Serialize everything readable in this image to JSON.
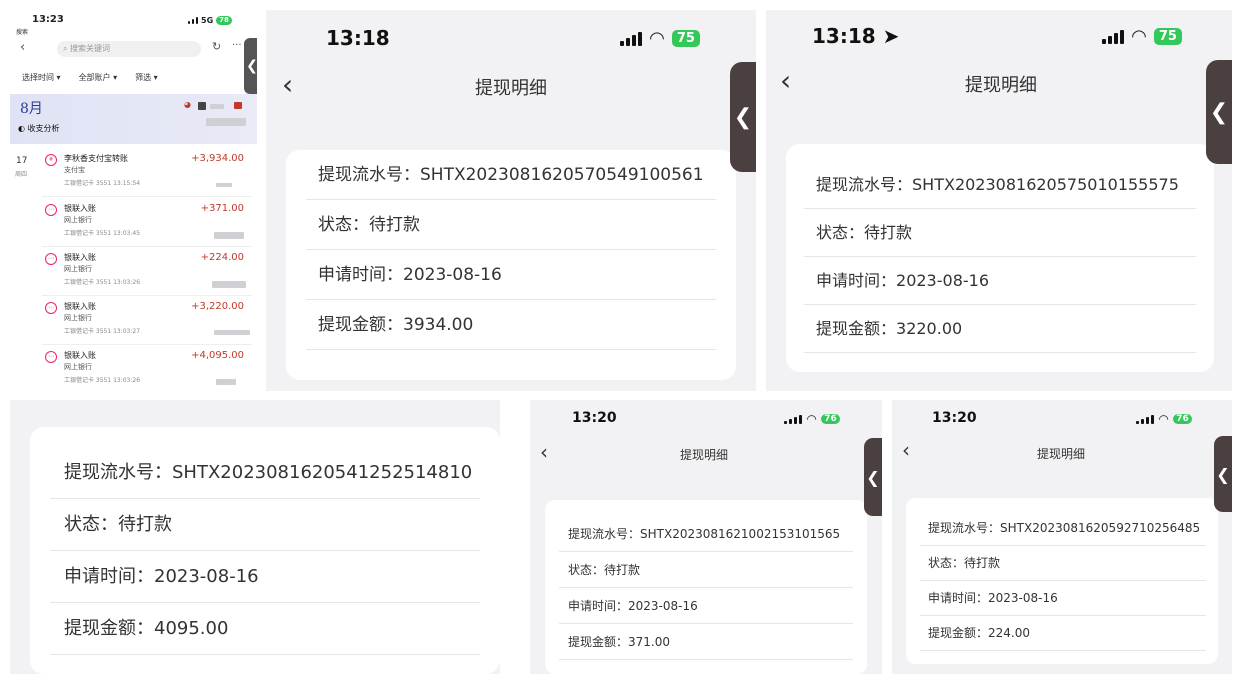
{
  "bank_app": {
    "time": "13:23",
    "back_label": "搜索",
    "network": "5G",
    "battery": "78",
    "search_placeholder": "搜索关键词",
    "filters": [
      "选择时间 ▾",
      "全部账户 ▾",
      "筛选 ▾"
    ],
    "month": "8月",
    "analysis": "收支分析",
    "day": "17",
    "weekday": "周四",
    "transactions": [
      {
        "name": "李秋香支付宝转账",
        "sub": "支付宝",
        "meta": "工银借记卡 3551 13:15:54",
        "amount": "+3,934.00"
      },
      {
        "name": "银联入账",
        "sub": "网上银行",
        "meta": "工银借记卡 3551 13:03:45",
        "amount": "+371.00"
      },
      {
        "name": "银联入账",
        "sub": "网上银行",
        "meta": "工银借记卡 3551 13:03:26",
        "amount": "+224.00"
      },
      {
        "name": "银联入账",
        "sub": "网上银行",
        "meta": "工银借记卡 3551 13:03:27",
        "amount": "+3,220.00"
      },
      {
        "name": "银联入账",
        "sub": "网上银行",
        "meta": "工银借记卡 3551 13:03:26",
        "amount": "+4,095.00"
      }
    ]
  },
  "labels": {
    "serial": "提现流水号：",
    "status": "状态：",
    "apply_time": "申请时间：",
    "amount": "提现金额："
  },
  "screens": [
    {
      "time": "13:18",
      "battery": "75",
      "title": "提现明细",
      "serial": "SHTX20230816205705491005​61",
      "status": "待打款",
      "date": "2023-08-16",
      "amount": "3934.00"
    },
    {
      "time": "13:18",
      "battery": "75",
      "title": "提现明细",
      "serial": "SHTX20230816205750101555​75",
      "status": "待打款",
      "date": "2023-08-16",
      "amount": "3220.00"
    },
    {
      "serial": "SHTX202308162054125251481​0",
      "status": "待打款",
      "date": "2023-08-16",
      "amount": "4095.00"
    },
    {
      "time": "13:20",
      "battery": "76",
      "title": "提现明细",
      "serial": "SHTX202308162100215310156​5",
      "status": "待打款",
      "date": "2023-08-16",
      "amount": "371.00"
    },
    {
      "time": "13:20",
      "battery": "76",
      "title": "提现明细",
      "serial": "SHTX202308162059271025648​5",
      "status": "待打款",
      "date": "2023-08-16",
      "amount": "224.00"
    }
  ]
}
